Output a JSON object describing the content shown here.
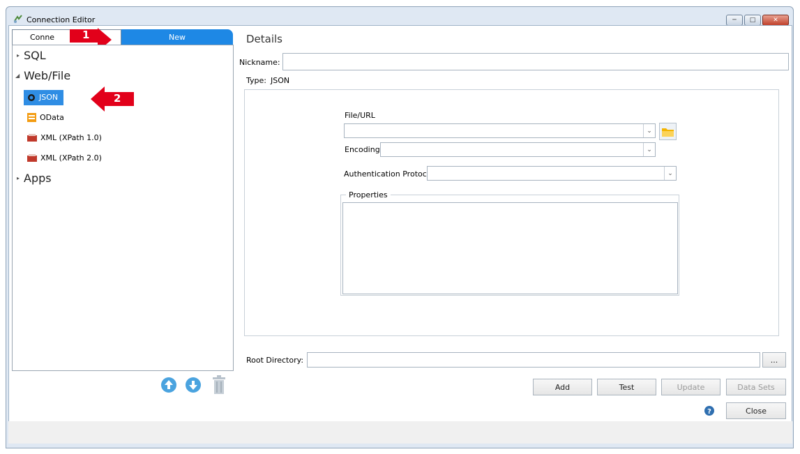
{
  "window": {
    "title": "Connection Editor"
  },
  "tabs": [
    {
      "label": "Conne"
    },
    {
      "label": "New"
    }
  ],
  "annotations": [
    {
      "label": "1"
    },
    {
      "label": "2"
    }
  ],
  "tree": {
    "categories": [
      {
        "label": "SQL"
      },
      {
        "label": "Web/File"
      },
      {
        "label": "Apps"
      }
    ],
    "items": [
      {
        "label": "JSON",
        "icon": "json-icon"
      },
      {
        "label": "OData",
        "icon": "odata-icon"
      },
      {
        "label": "XML (XPath 1.0)",
        "icon": "xml-icon"
      },
      {
        "label": "XML (XPath 2.0)",
        "icon": "xml-icon"
      }
    ]
  },
  "details": {
    "heading": "Details",
    "nickname_label": "Nickname:",
    "nickname_value": "",
    "type_label": "Type:",
    "type_value": "JSON",
    "file_url_label": "File/URL",
    "file_url_value": "",
    "encoding_label": "Encoding:",
    "encoding_value": "",
    "auth_label": "Authentication Protocol",
    "auth_value": "",
    "properties_label": "Properties",
    "root_dir_label": "Root Directory:",
    "root_dir_value": "",
    "browse_label": "..."
  },
  "buttons": {
    "add": "Add",
    "test": "Test",
    "update": "Update",
    "data_sets": "Data Sets",
    "close": "Close"
  },
  "colors": {
    "accent": "#1e88e5",
    "selection": "#2f8de4",
    "callout": "#e2001a"
  }
}
